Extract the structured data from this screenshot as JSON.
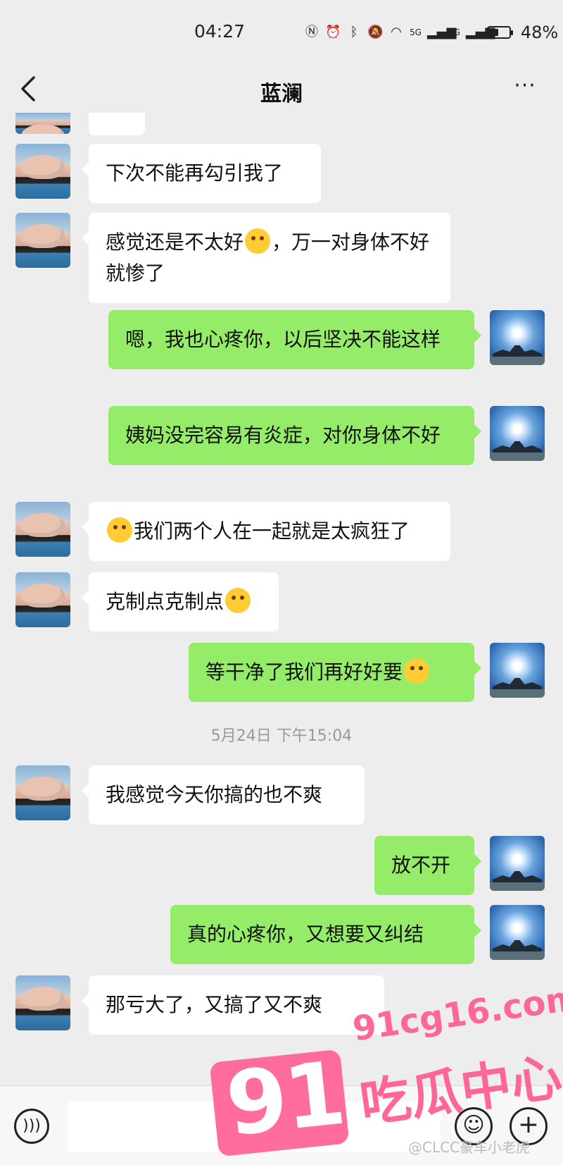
{
  "status": {
    "time": "04:27",
    "battery": "48%",
    "battery_level": 0.48,
    "network_1": "5G",
    "network_2": "4G"
  },
  "nav": {
    "title": "蓝澜"
  },
  "messages": [
    {
      "side": "left",
      "text": "下次不能再勾引我了"
    },
    {
      "side": "left",
      "text_before": "感觉还是不太好",
      "emoji": "tears-of-joy",
      "text_after": "，万一对身体不好就惨了"
    },
    {
      "side": "right",
      "text": "嗯，我也心疼你，以后坚决不能这样"
    },
    {
      "side": "right",
      "text": "姨妈没完容易有炎症，对你身体不好"
    },
    {
      "side": "left",
      "emoji": "sleepy-face",
      "text_after": "我们两个人在一起就是太疯狂了"
    },
    {
      "side": "left",
      "text_before": "克制点克制点",
      "emoji": "dizzy-face"
    },
    {
      "side": "right",
      "text_before": "等干净了我们再好好要",
      "emoji": "smiling-face"
    },
    {
      "side": "left",
      "text": "我感觉今天你搞的也不爽"
    },
    {
      "side": "right",
      "text": "放不开"
    },
    {
      "side": "right",
      "text": "真的心疼你，又想要又纠结"
    },
    {
      "side": "left",
      "text": "那亏大了，又搞了又不爽"
    }
  ],
  "timestamp": "5月24日 下午15:04",
  "watermark": {
    "number": "91",
    "domain": "91cg16.com",
    "label": "吃瓜中心",
    "credit": "@CLCC豪车小老虎"
  },
  "icons": {
    "back": "chevron-left-icon",
    "more": "more-dots-icon",
    "voice": "voice-icon",
    "emoji": "emoji-icon",
    "plus": "plus-icon"
  },
  "colors": {
    "background": "#ededed",
    "bubble_sent": "#95ec69",
    "bubble_received": "#ffffff",
    "watermark": "#ff5f95"
  }
}
